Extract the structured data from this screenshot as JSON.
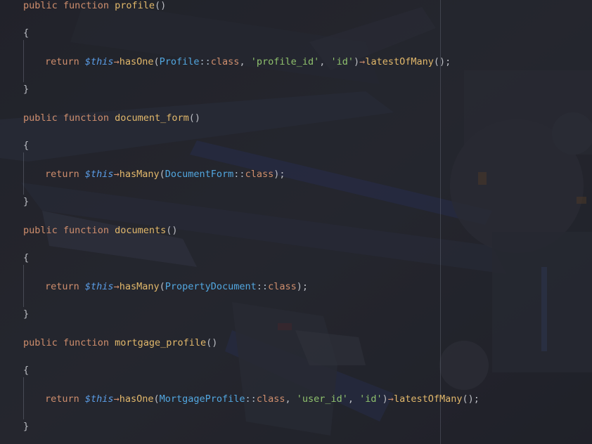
{
  "editor": {
    "methods": [
      {
        "signature": {
          "keyword_public": "public",
          "keyword_function": "function",
          "name": "profile",
          "parens": "()"
        },
        "open_brace": "{",
        "body": {
          "return_kw": "return",
          "this_var": "$this",
          "arrow1": "→",
          "call": "hasOne",
          "open_paren": "(",
          "class_name": "Profile",
          "double_colon": "::",
          "class_kw": "class",
          "sep1": ", ",
          "arg1": "'profile_id'",
          "sep2": ", ",
          "arg2": "'id'",
          "close_paren": ")",
          "arrow2": "→",
          "chain_call": "latestOfMany",
          "end": "();"
        },
        "close_brace": "}"
      },
      {
        "signature": {
          "keyword_public": "public",
          "keyword_function": "function",
          "name": "document_form",
          "parens": "()"
        },
        "open_brace": "{",
        "body": {
          "return_kw": "return",
          "this_var": "$this",
          "arrow1": "→",
          "call": "hasMany",
          "open_paren": "(",
          "class_name": "DocumentForm",
          "double_colon": "::",
          "class_kw": "class",
          "end": ");"
        },
        "close_brace": "}"
      },
      {
        "signature": {
          "keyword_public": "public",
          "keyword_function": "function",
          "name": "documents",
          "parens": "()"
        },
        "open_brace": "{",
        "body": {
          "return_kw": "return",
          "this_var": "$this",
          "arrow1": "→",
          "call": "hasMany",
          "open_paren": "(",
          "class_name": "PropertyDocument",
          "double_colon": "::",
          "class_kw": "class",
          "end": ");"
        },
        "close_brace": "}"
      },
      {
        "signature": {
          "keyword_public": "public",
          "keyword_function": "function",
          "name": "mortgage_profile",
          "parens": "()"
        },
        "open_brace": "{",
        "body": {
          "return_kw": "return",
          "this_var": "$this",
          "arrow1": "→",
          "call": "hasOne",
          "open_paren": "(",
          "class_name": "MortgageProfile",
          "double_colon": "::",
          "class_kw": "class",
          "sep1": ", ",
          "arg1": "'user_id'",
          "sep2": ", ",
          "arg2": "'id'",
          "close_paren": ")",
          "arrow2": "→",
          "chain_call": "latestOfMany",
          "end": "();"
        },
        "close_brace": "}"
      }
    ]
  }
}
